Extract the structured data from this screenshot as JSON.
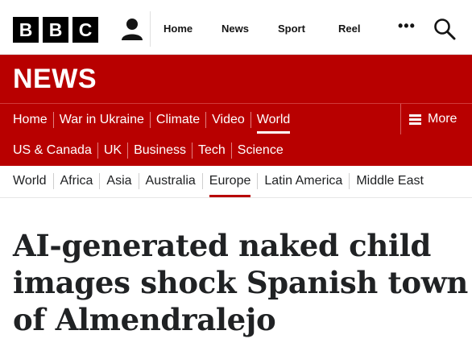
{
  "masthead": {
    "logo_letters": [
      "B",
      "B",
      "C"
    ],
    "nav": [
      "Home",
      "News",
      "Sport",
      "Reel"
    ],
    "more_label": "•••",
    "icons": {
      "account": "account-icon",
      "search": "search-icon"
    }
  },
  "brand": {
    "title": "NEWS",
    "color": "#b80000"
  },
  "section_nav": {
    "row1": [
      "Home",
      "War in Ukraine",
      "Climate",
      "Video",
      "World"
    ],
    "row2": [
      "US & Canada",
      "UK",
      "Business",
      "Tech",
      "Science"
    ],
    "active": "World",
    "more_label": "More"
  },
  "sub_nav": {
    "items": [
      "World",
      "Africa",
      "Asia",
      "Australia",
      "Europe",
      "Latin America",
      "Middle East"
    ],
    "active": "Europe"
  },
  "article": {
    "headline": "AI-generated naked child images shock Spanish town of Almendralejo"
  }
}
